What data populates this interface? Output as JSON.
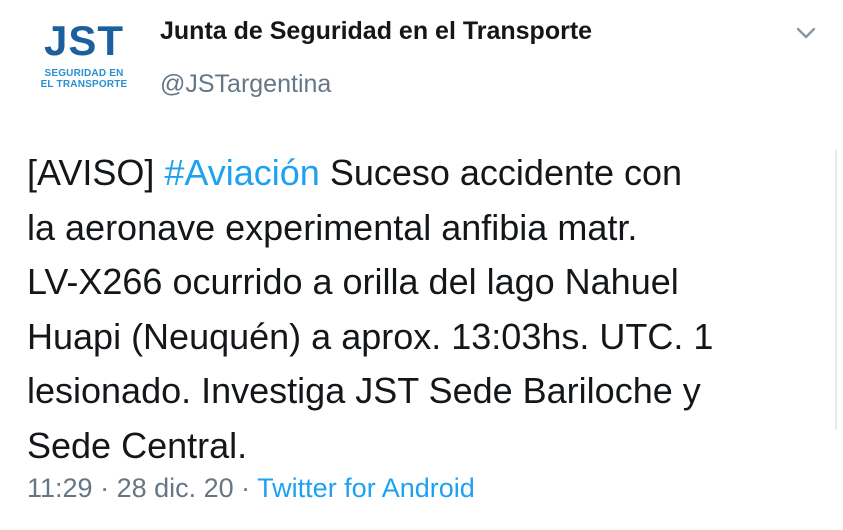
{
  "tweet": {
    "avatar": {
      "logo_text": "JST",
      "logo_sub_line1": "SEGURIDAD EN",
      "logo_sub_line2": "EL TRANSPORTE",
      "brand_color": "#1b5f9e",
      "accent_color": "#2a8fd0"
    },
    "display_name": "Junta de Seguridad en el Transporte",
    "handle": "@JSTargentina",
    "menu_icon": "chevron-down-icon",
    "body": {
      "line1_prefix": "[AVISO] ",
      "hashtag": "#Aviación",
      "line1_suffix": " Suceso accidente con",
      "line2": "la aeronave experimental anfibia matr.",
      "line3": "LV-X266 ocurrido a orilla del lago Nahuel",
      "line4": "Huapi (Neuquén) a aprox. 13:03hs. UTC. 1",
      "line5": "lesionado. Investiga JST Sede Bariloche y",
      "line6": "Sede Central."
    },
    "meta": {
      "time": "11:29",
      "separator": " · ",
      "date": "28 dic. 20",
      "source": "Twitter for Android"
    },
    "colors": {
      "link": "#1da1f2",
      "secondary_text": "#657786",
      "primary_text": "#14171a"
    }
  }
}
